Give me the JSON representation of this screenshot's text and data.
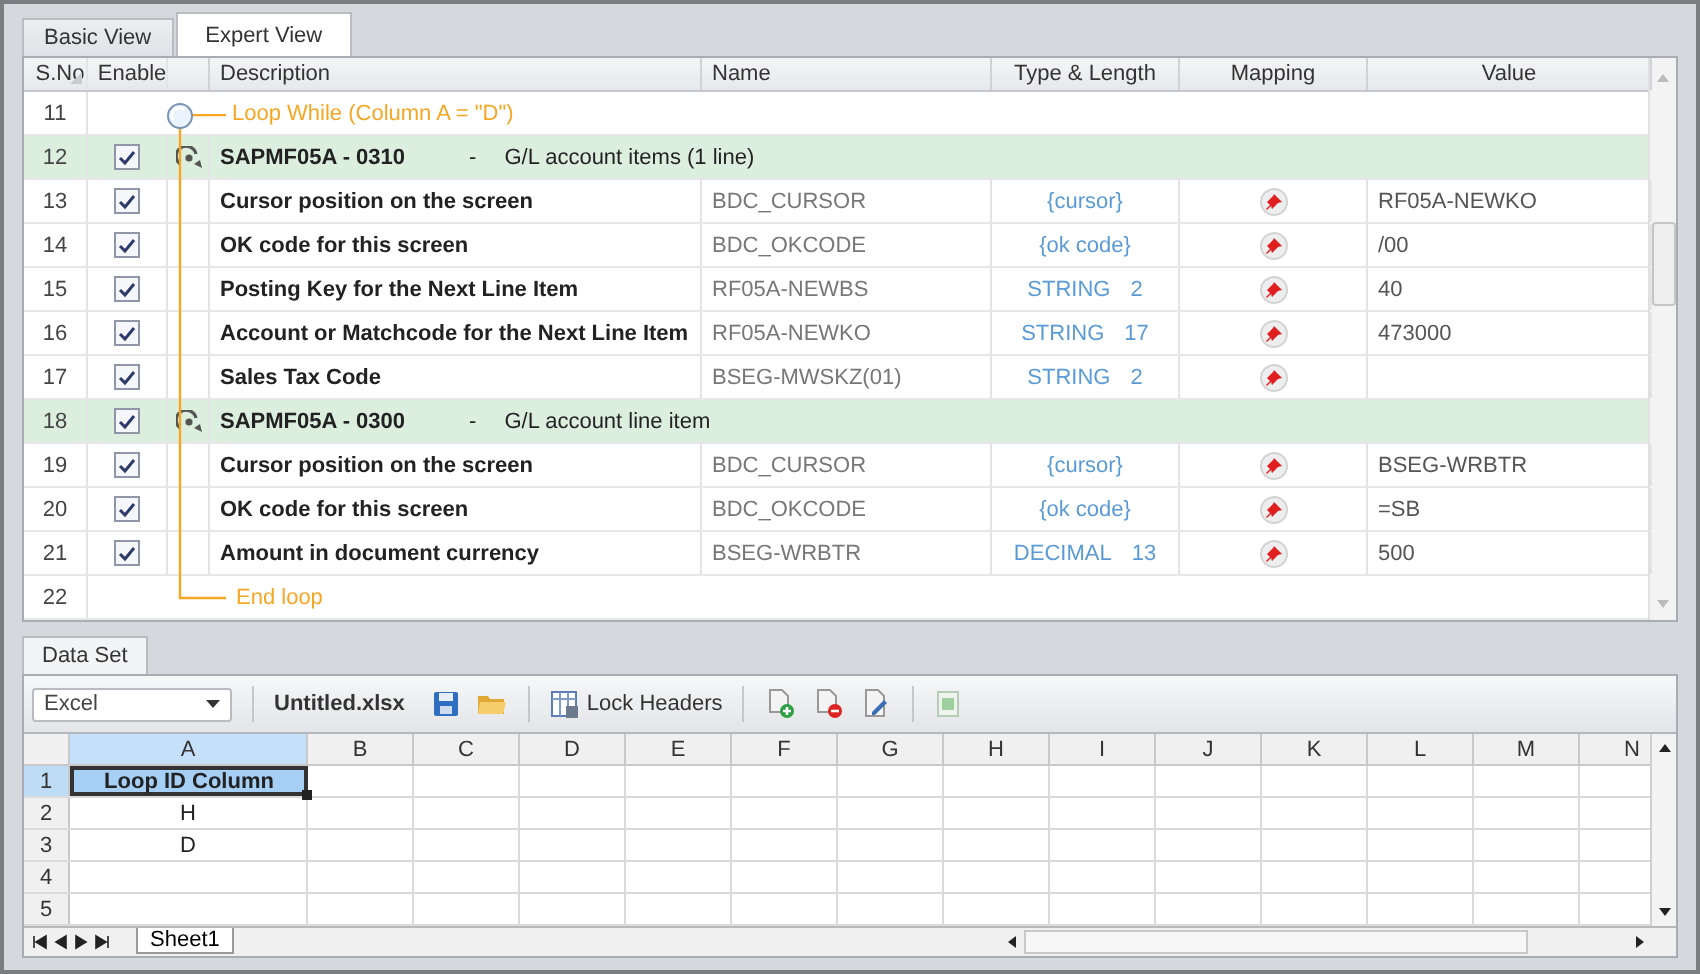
{
  "tabs": [
    {
      "label": "Basic View",
      "selected": false
    },
    {
      "label": "Expert View",
      "selected": true
    }
  ],
  "grid": {
    "columns": [
      "S.No",
      "Enable",
      "Description",
      "Name",
      "Type & Length",
      "Mapping",
      "Value"
    ],
    "rows": [
      {
        "kind": "loop_start",
        "sno": "11",
        "label": "Loop While (Column A = \"D\")"
      },
      {
        "kind": "screen",
        "sno": "12",
        "enabled": true,
        "program": "SAPMF05A - 0310",
        "dash": "-",
        "title": "G/L account items (1 line)"
      },
      {
        "kind": "field",
        "sno": "13",
        "enabled": true,
        "description": "Cursor position on the screen",
        "name": "BDC_CURSOR",
        "type": "{cursor}",
        "value": "RF05A-NEWKO"
      },
      {
        "kind": "field",
        "sno": "14",
        "enabled": true,
        "description": "OK code for this screen",
        "name": "BDC_OKCODE",
        "type": "{ok code}",
        "value": "/00"
      },
      {
        "kind": "field",
        "sno": "15",
        "enabled": true,
        "description": "Posting Key for the Next Line Item",
        "name": "RF05A-NEWBS",
        "type": "STRING",
        "length": "2",
        "value": "40"
      },
      {
        "kind": "field",
        "sno": "16",
        "enabled": true,
        "description": "Account or Matchcode for the Next Line Item",
        "name": "RF05A-NEWKO",
        "type": "STRING",
        "length": "17",
        "value": "473000"
      },
      {
        "kind": "field",
        "sno": "17",
        "enabled": true,
        "description": "Sales Tax Code",
        "name": "BSEG-MWSKZ(01)",
        "type": "STRING",
        "length": "2"
      },
      {
        "kind": "screen",
        "sno": "18",
        "enabled": true,
        "program": "SAPMF05A - 0300",
        "dash": "-",
        "title": "G/L account line item"
      },
      {
        "kind": "field",
        "sno": "19",
        "enabled": true,
        "description": "Cursor position on the screen",
        "name": "BDC_CURSOR",
        "type": "{cursor}",
        "value": "BSEG-WRBTR"
      },
      {
        "kind": "field",
        "sno": "20",
        "enabled": true,
        "description": "OK code for this screen",
        "name": "BDC_OKCODE",
        "type": "{ok code}",
        "value": "=SB"
      },
      {
        "kind": "field",
        "sno": "21",
        "enabled": true,
        "description": "Amount in document currency",
        "name": "BSEG-WRBTR",
        "type": "DECIMAL",
        "length": "13",
        "value": "500"
      },
      {
        "kind": "loop_end",
        "sno": "22",
        "label": "End loop"
      }
    ]
  },
  "data_set": {
    "tab": {
      "label": "Data Set",
      "selected": true
    },
    "format": "Excel",
    "file_name": "Untitled.xlsx",
    "lock_headers": "Lock Headers",
    "columns": [
      {
        "label": "A",
        "selected": true
      },
      {
        "label": "B",
        "selected": false
      },
      {
        "label": "C",
        "selected": false
      },
      {
        "label": "D",
        "selected": false
      },
      {
        "label": "E",
        "selected": false
      },
      {
        "label": "F",
        "selected": false
      },
      {
        "label": "G",
        "selected": false
      },
      {
        "label": "H",
        "selected": false
      },
      {
        "label": "I",
        "selected": false
      },
      {
        "label": "J",
        "selected": false
      },
      {
        "label": "K",
        "selected": false
      },
      {
        "label": "L",
        "selected": false
      },
      {
        "label": "M",
        "selected": false
      },
      {
        "label": "N",
        "selected": false
      }
    ],
    "rows": [
      {
        "label": "1",
        "selected": true,
        "cells": [
          {
            "text": "Loop ID Column",
            "selected": true
          }
        ]
      },
      {
        "label": "2",
        "selected": false,
        "cells": [
          {
            "text": "H",
            "selected": false
          }
        ]
      },
      {
        "label": "3",
        "selected": false,
        "cells": [
          {
            "text": "D",
            "selected": false
          }
        ]
      },
      {
        "label": "4",
        "selected": false
      },
      {
        "label": "5",
        "selected": false
      }
    ],
    "sheet_tabs": [
      {
        "label": "Sheet1",
        "selected": true
      }
    ]
  }
}
